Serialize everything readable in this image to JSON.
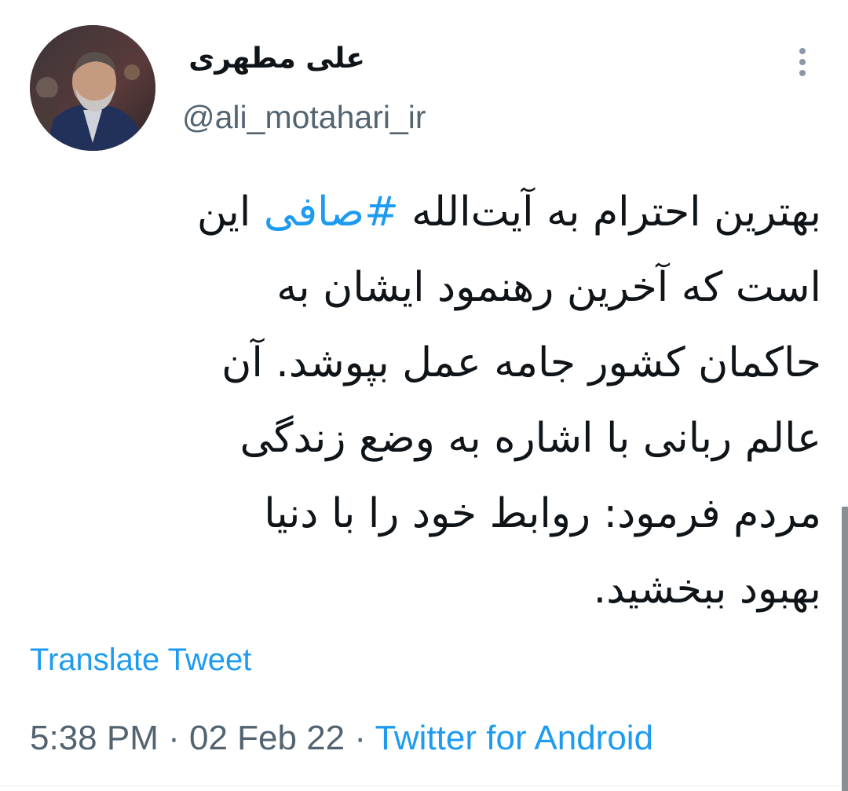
{
  "author": {
    "display_name": "علی مطهری",
    "handle": "@ali_motahari_ir",
    "avatar_icon": "profile-photo"
  },
  "menu": {
    "icon": "more-vertical-icon"
  },
  "tweet": {
    "lines": [
      {
        "before": "بهترین احترام به آیت‌الله ",
        "hashtag": "#صافی",
        "after": " این"
      },
      {
        "text": "است که آخرین رهنمود ایشان به"
      },
      {
        "text": "حاکمان کشور جامه عمل بپوشد. آن"
      },
      {
        "text": "عالم ربانی با اشاره به وضع زندگی"
      },
      {
        "text": "مردم فرمود: روابط خود را با دنیا"
      },
      {
        "text": "بهبود ببخشید."
      }
    ]
  },
  "translate_label": "Translate Tweet",
  "meta": {
    "time": "5:38 PM",
    "separator": " · ",
    "date": "02 Feb 22",
    "source": "Twitter for Android"
  },
  "colors": {
    "link": "#1d9bf0",
    "secondary": "#536471",
    "text": "#0f1419"
  }
}
